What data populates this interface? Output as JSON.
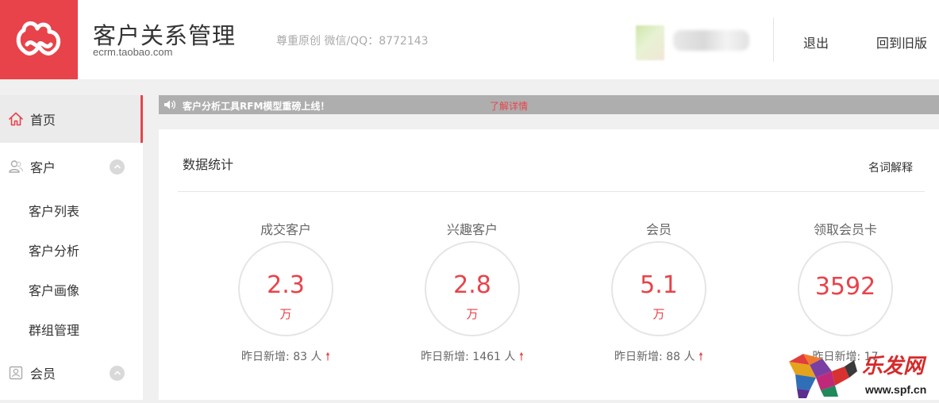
{
  "header": {
    "title": "客户关系管理",
    "domain": "ecrm.taobao.com",
    "slogan": "尊重原创 微信/QQ：8772143",
    "logout": "退出",
    "old_version": "回到旧版"
  },
  "sidebar": {
    "items": [
      {
        "label": "首页",
        "icon": "home-icon",
        "active": true
      },
      {
        "label": "客户",
        "icon": "users-icon",
        "expandable": true
      },
      {
        "label": "客户列表"
      },
      {
        "label": "客户分析"
      },
      {
        "label": "客户画像"
      },
      {
        "label": "群组管理"
      },
      {
        "label": "会员",
        "icon": "member-card-icon",
        "expandable": true
      }
    ]
  },
  "notice": {
    "text": "客户分析工具RFM模型重磅上线！",
    "link": "了解详情"
  },
  "stats_panel": {
    "title": "数据统计",
    "help_link": "名词解释",
    "cards": [
      {
        "label": "成交客户",
        "value": "2.3",
        "unit": "万",
        "foot_prefix": "昨日新增: ",
        "foot_value": "83 人"
      },
      {
        "label": "兴趣客户",
        "value": "2.8",
        "unit": "万",
        "foot_prefix": "昨日新增: ",
        "foot_value": "1461 人"
      },
      {
        "label": "会员",
        "value": "5.1",
        "unit": "万",
        "foot_prefix": "昨日新增: ",
        "foot_value": "88 人"
      },
      {
        "label": "领取会员卡",
        "value": "3592",
        "unit": "",
        "foot_prefix": "昨日新增: ",
        "foot_value": "17"
      }
    ]
  },
  "watermark": {
    "brand": "乐发网",
    "url": "www.spf.cn"
  },
  "colors": {
    "accent": "#e8434a",
    "notice_bg": "#aeaeae",
    "page_bg": "#f0f0f0"
  }
}
